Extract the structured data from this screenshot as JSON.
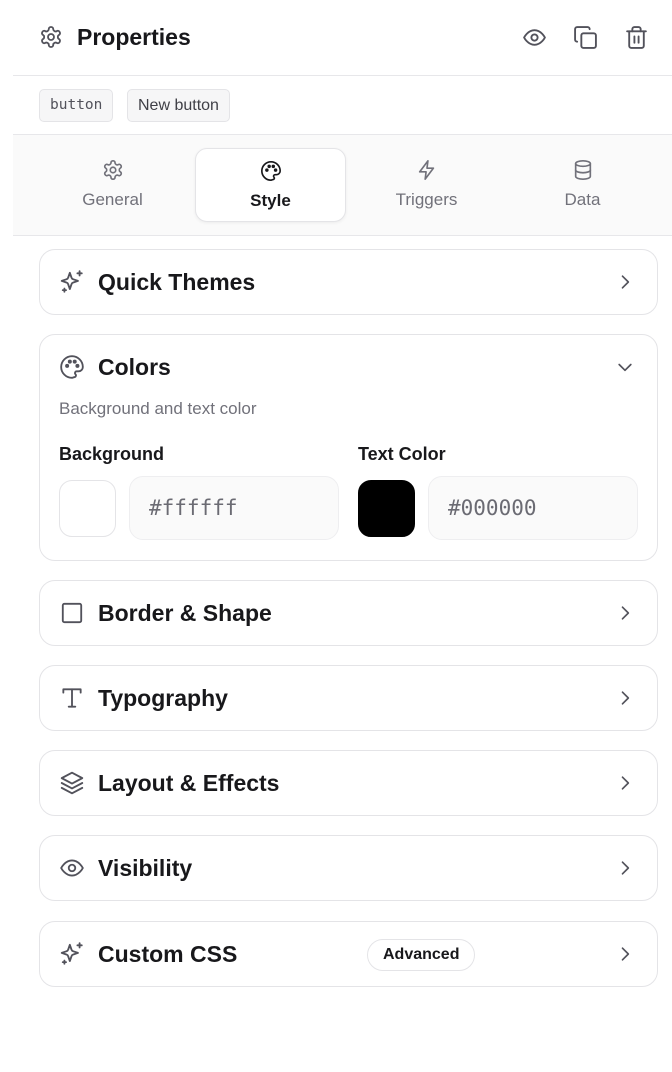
{
  "header": {
    "title": "Properties",
    "icons": [
      "gear-icon",
      "eye-icon",
      "copy-icon",
      "trash-icon"
    ]
  },
  "tags": {
    "type": "button",
    "name": "New button"
  },
  "tabs": [
    {
      "label": "General",
      "icon": "gear-icon",
      "active": false
    },
    {
      "label": "Style",
      "icon": "palette-icon",
      "active": true
    },
    {
      "label": "Triggers",
      "icon": "lightning-icon",
      "active": false
    },
    {
      "label": "Data",
      "icon": "database-icon",
      "active": false
    }
  ],
  "sections": {
    "quick_themes": {
      "title": "Quick Themes",
      "icon": "sparkles-icon",
      "expanded": false
    },
    "colors": {
      "title": "Colors",
      "icon": "palette-icon",
      "expanded": true,
      "description": "Background and text color",
      "background_label": "Background",
      "background_value": "#ffffff",
      "text_color_label": "Text Color",
      "text_color_value": "#000000"
    },
    "border_shape": {
      "title": "Border & Shape",
      "icon": "square-icon",
      "expanded": false
    },
    "typography": {
      "title": "Typography",
      "icon": "type-icon",
      "expanded": false
    },
    "layout_effects": {
      "title": "Layout & Effects",
      "icon": "layers-icon",
      "expanded": false
    },
    "visibility": {
      "title": "Visibility",
      "icon": "eye-icon",
      "expanded": false
    },
    "custom_css": {
      "title": "Custom CSS",
      "icon": "sparkles-icon",
      "badge": "Advanced",
      "expanded": false
    }
  },
  "colors": {
    "accent_text": "#18181b",
    "muted_text": "#71717a",
    "border": "#e4e4e7"
  }
}
